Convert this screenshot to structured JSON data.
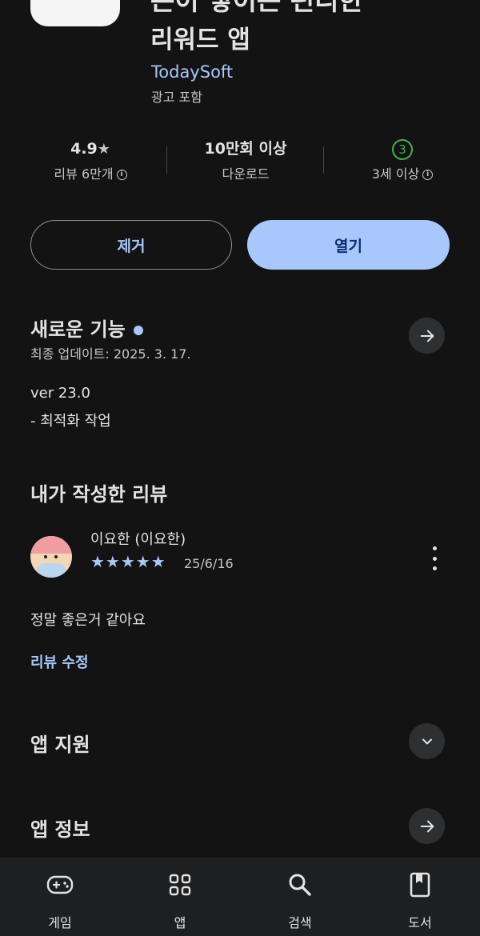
{
  "app": {
    "title_line1": "돈이 쌓이는 편리한",
    "title_line2": "리워드 앱",
    "developer": "TodaySoft",
    "ads_label": "광고 포함"
  },
  "stats": {
    "rating_value": "4.9",
    "rating_star": "★",
    "rating_label": "리뷰 6만개",
    "downloads_value": "10만회 이상",
    "downloads_label": "다운로드",
    "age_value": "3",
    "age_label": "3세 이상"
  },
  "actions": {
    "remove_label": "제거",
    "open_label": "열기"
  },
  "whats_new": {
    "title": "새로운 기능",
    "updated": "최종 업데이트: 2025. 3. 17.",
    "line1": "ver 23.0",
    "line2": "- 최적화 작업"
  },
  "my_review": {
    "title": "내가 작성한 리뷰",
    "user": "이요한 (이요한)",
    "stars": "★★★★★",
    "rating": 5,
    "date": "25/6/16",
    "text": "정말 좋은거 같아요",
    "edit_label": "리뷰 수정"
  },
  "sections": {
    "support": "앱 지원",
    "info": "앱 정보"
  },
  "nav": {
    "items": [
      {
        "label": "게임",
        "icon": "gamepad-icon"
      },
      {
        "label": "앱",
        "icon": "apps-grid-icon"
      },
      {
        "label": "검색",
        "icon": "search-icon"
      },
      {
        "label": "도서",
        "icon": "book-icon"
      }
    ]
  },
  "colors": {
    "background": "#131314",
    "accent": "#a8c7fa",
    "age_badge": "#3fb34f",
    "nav_background": "#1e1f20"
  }
}
